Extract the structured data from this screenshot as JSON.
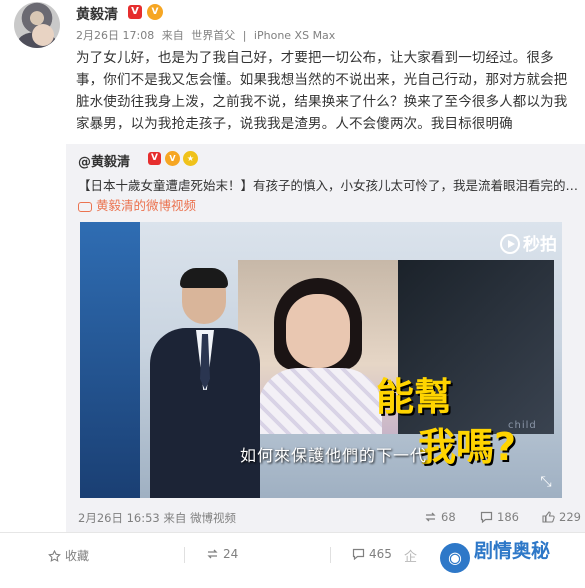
{
  "post": {
    "author": "黄毅清",
    "v_badge": "V",
    "vip_badge": "V",
    "time": "2月26日 17:08",
    "source_prefix": "来自",
    "source_1": "世界首父",
    "source_2": "iPhone XS Max",
    "source_sep": "|",
    "text": "为了女儿好，也是为了我自己好，才要把一切公布，让大家看到一切经过。很多事，你们不是我又怎会懂。如果我想当然的不说出来，光自己行动，那对方就会把脏水使劲往我身上泼，之前我不说，结果换来了什么？换来了至今很多人都以为我家暴男，以为我抢走孩子，说我我是渣男。人不会傻两次。我目标很明确"
  },
  "repost": {
    "author": "@黄毅清",
    "v_badge": "V",
    "vip_badge": "V",
    "text": "【日本十歲女童遭虐死始末！】有孩子的慎入，小女孩儿太可怜了，我是流着眼泪看完的……",
    "video_link": "黄毅清的微博视频",
    "video": {
      "brand": "秒拍",
      "overlay_line1": "能幫",
      "overlay_line2": "我嗎?",
      "overlay_en": "child",
      "subtitle": "如何來保護他們的下一代"
    },
    "time": "2月26日 16:53",
    "source_prefix": "来自",
    "source": "微博视频",
    "reposts": "68",
    "comments": "186",
    "likes": "229"
  },
  "actions": {
    "favorite": "收藏",
    "repost": "24",
    "comment": "465"
  },
  "watermark": {
    "text": "剧情奥秘",
    "faint": "企"
  },
  "colors": {
    "accent_link": "#eb7350",
    "v_red": "#e62e2e",
    "vip_orange": "#f6a623",
    "watermark_blue": "#2e78c8"
  }
}
